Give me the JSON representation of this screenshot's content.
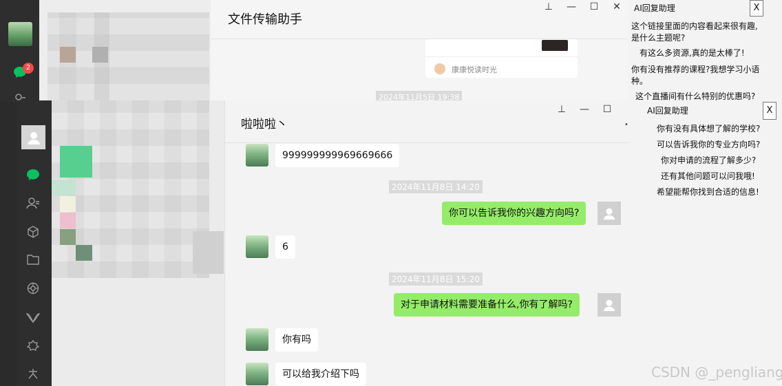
{
  "back_window": {
    "title": "文件传输助手",
    "unread_badge": "2",
    "card_source": "康康悦读时光",
    "timestamp": "2024年11月5日 19:38"
  },
  "ai_popup_1": {
    "title": "AI回复助理",
    "close_label": "X",
    "lines": [
      "这个链接里面的内容看起来很有趣,",
      "是什么主题呢?",
      "有这么多资源,真的是太棒了!",
      "你有没有推荐的课程?我想学习小语",
      "种。",
      "这个直播间有什么特别的优惠吗?"
    ]
  },
  "front_window": {
    "title": "啦啦啦丶",
    "messages": [
      {
        "side": "left",
        "text": "999999999969669666"
      },
      {
        "side": "time",
        "text": "2024年11月8日 14:20"
      },
      {
        "side": "right",
        "text": "你可以告诉我你的兴趣方向吗?"
      },
      {
        "side": "left",
        "text": "6"
      },
      {
        "side": "time",
        "text": "2024年11月8日 15:20"
      },
      {
        "side": "right",
        "text": "对于申请材料需要准备什么,你有了解吗?"
      },
      {
        "side": "left",
        "text": "你有吗"
      },
      {
        "side": "left",
        "text": "可以给我介绍下吗"
      }
    ]
  },
  "ai_popup_2": {
    "title": "AI回复助理",
    "close_label": "X",
    "lines": [
      "你有没有具体想了解的学校?",
      "可以告诉我你的专业方向吗?",
      "你对申请的流程了解多少?",
      "还有其他问题可以问我哦!",
      "希望能帮你找到合适的信息!"
    ]
  },
  "window_controls": {
    "pin": "⊥",
    "minimize": "—",
    "maximize": "☐",
    "close": "✕"
  },
  "watermark": "CSDN @_pengliang",
  "colors": {
    "self_bubble": "#95ec69",
    "badge": "#f54747",
    "nav_active": "#07c160"
  }
}
